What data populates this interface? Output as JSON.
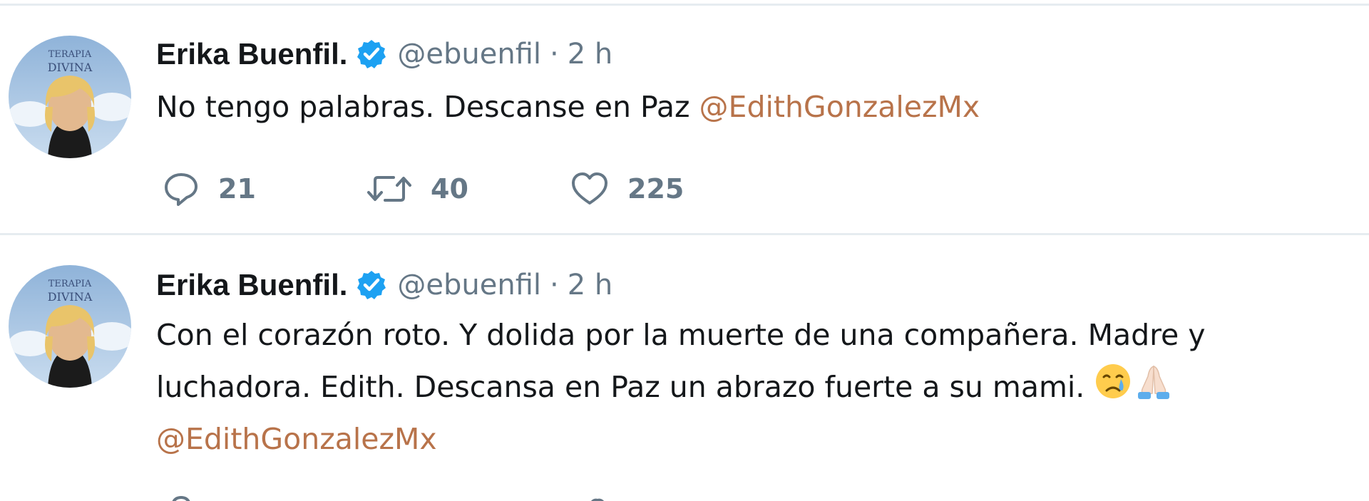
{
  "tweets": [
    {
      "display_name": "Erika Buenfil.",
      "verified_icon": "verified-badge-icon",
      "handle": "@ebuenfil",
      "separator": "·",
      "time": "2 h",
      "avatar_text": [
        "TERAPIA",
        "DIVINA"
      ],
      "text_lines": [
        {
          "plain": "No tengo palabras. Descanse en Paz ",
          "mention": "@EdithGonzalezMx"
        }
      ],
      "actions": {
        "replies": "21",
        "retweets": "40",
        "likes": "225"
      }
    },
    {
      "display_name": "Erika Buenfil.",
      "verified_icon": "verified-badge-icon",
      "handle": "@ebuenfil",
      "separator": "·",
      "time": "2 h",
      "avatar_text": [
        "TERAPIA",
        "DIVINA"
      ],
      "text_lines": [
        {
          "plain": "Con el corazón roto. Y dolida por la muerte de una compañera. Madre y",
          "mention": ""
        },
        {
          "plain": "luchadora. Edith. Descansa en Paz un abrazo fuerte a su mami. ",
          "mention": ""
        },
        {
          "plain": "",
          "mention": "@EdithGonzalezMx"
        }
      ],
      "emojis": [
        "crying-face-icon",
        "folded-hands-icon"
      ]
    }
  ],
  "colors": {
    "mention": "#b8734a",
    "muted": "#657786",
    "verified": "#1da1f2",
    "divider": "#e6ecf0"
  }
}
